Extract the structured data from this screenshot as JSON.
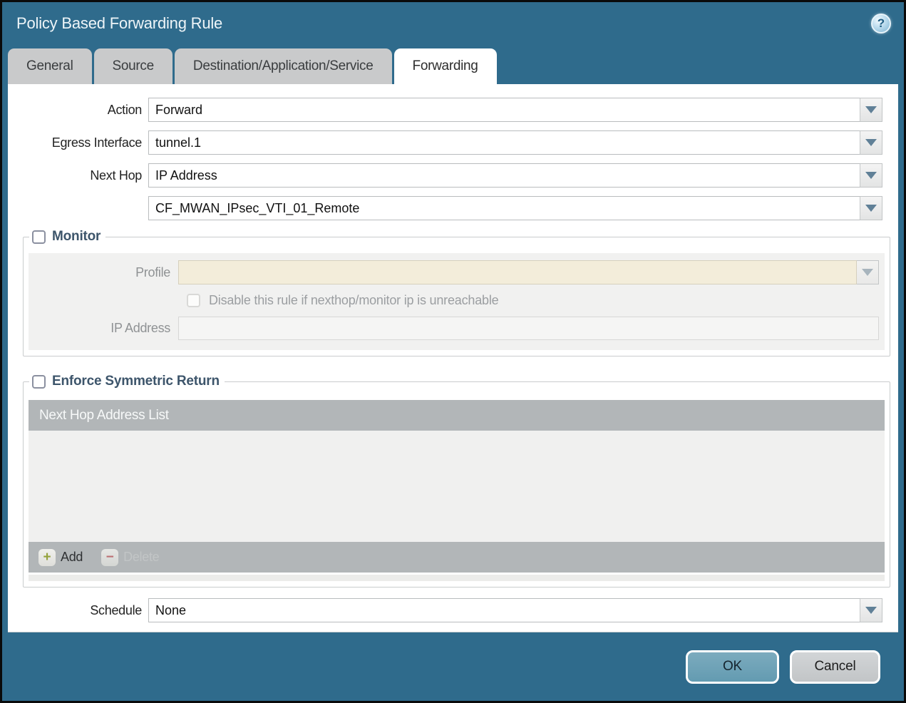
{
  "dialog": {
    "title": "Policy Based Forwarding Rule",
    "help_glyph": "?"
  },
  "tabs": [
    {
      "label": "General",
      "active": false
    },
    {
      "label": "Source",
      "active": false
    },
    {
      "label": "Destination/Application/Service",
      "active": false
    },
    {
      "label": "Forwarding",
      "active": true
    }
  ],
  "form": {
    "action": {
      "label": "Action",
      "value": "Forward"
    },
    "egress_interface": {
      "label": "Egress Interface",
      "value": "tunnel.1"
    },
    "next_hop": {
      "label": "Next Hop",
      "value": "IP Address"
    },
    "next_hop_address": {
      "label": "",
      "value": "CF_MWAN_IPsec_VTI_01_Remote"
    },
    "schedule": {
      "label": "Schedule",
      "value": "None"
    }
  },
  "monitor": {
    "title": "Monitor",
    "checked": false,
    "profile": {
      "label": "Profile",
      "value": ""
    },
    "disable_rule_label": "Disable this rule if nexthop/monitor ip is unreachable",
    "disable_rule_checked": false,
    "ip_address": {
      "label": "IP Address",
      "value": ""
    }
  },
  "symmetric_return": {
    "title": "Enforce Symmetric Return",
    "checked": false,
    "table_header": "Next Hop Address List",
    "rows": [],
    "add_label": "Add",
    "add_glyph": "+",
    "delete_label": "Delete",
    "delete_glyph": "−",
    "delete_enabled": false
  },
  "footer": {
    "ok_label": "OK",
    "cancel_label": "Cancel"
  },
  "colors": {
    "titlebar_teal": "#2f6b8c",
    "tab_inactive": "#c9cacb",
    "section_title": "#3d556b",
    "table_header_gray": "#b2b6b8",
    "profile_disabled_beige": "#f3edda",
    "ok_button": "#6ca2b8",
    "cancel_button": "#c9ccce",
    "add_plus_green": "#94a23b",
    "delete_minus_red": "#bd6f72"
  }
}
